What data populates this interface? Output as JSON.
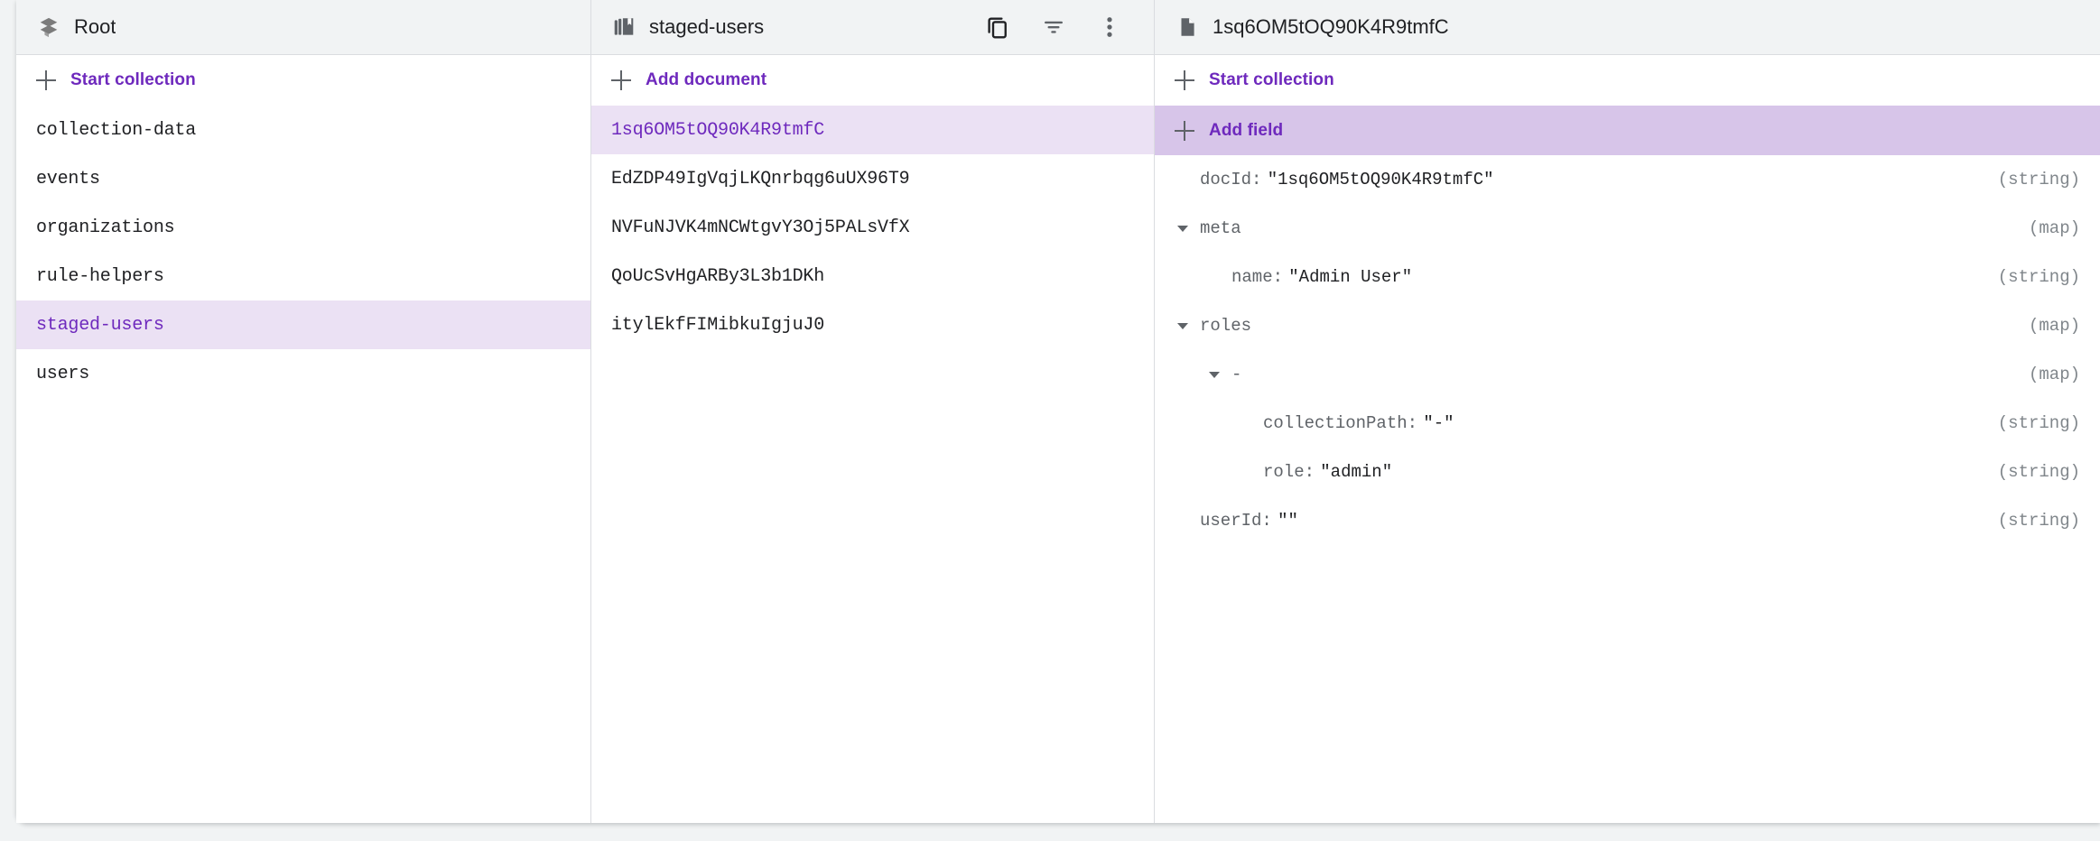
{
  "left_panel": {
    "header": {
      "icon": "firestore-root-icon",
      "title": "Root"
    },
    "add_action": {
      "icon": "plus-icon",
      "label": "Start collection"
    },
    "items": [
      {
        "label": "collection-data",
        "selected": false
      },
      {
        "label": "events",
        "selected": false
      },
      {
        "label": "organizations",
        "selected": false
      },
      {
        "label": "rule-helpers",
        "selected": false
      },
      {
        "label": "staged-users",
        "selected": true
      },
      {
        "label": "users",
        "selected": false
      }
    ]
  },
  "middle_panel": {
    "header": {
      "icon": "collection-icon",
      "title": "staged-users",
      "actions": [
        {
          "icon": "copy-icon",
          "name": "copy-collection-path-button"
        },
        {
          "icon": "filter-icon",
          "name": "filter-query-button"
        },
        {
          "icon": "more-vert-icon",
          "name": "more-options-button"
        }
      ]
    },
    "add_action": {
      "icon": "plus-icon",
      "label": "Add document"
    },
    "items": [
      {
        "label": "1sq6OM5tOQ90K4R9tmfC",
        "selected": true
      },
      {
        "label": "EdZDP49IgVqjLKQnrbqg6uUX96T9",
        "selected": false
      },
      {
        "label": "NVFuNJVK4mNCWtgvY3Oj5PALsVfX",
        "selected": false
      },
      {
        "label": "QoUcSvHgARBy3L3b1DKh",
        "selected": false
      },
      {
        "label": "itylEkfFIMibkuIgjuJ0",
        "selected": false
      }
    ]
  },
  "right_panel": {
    "header": {
      "icon": "document-icon",
      "title": "1sq6OM5tOQ90K4R9tmfC"
    },
    "start_collection": {
      "icon": "plus-icon",
      "label": "Start collection"
    },
    "add_field": {
      "icon": "plus-icon",
      "label": "Add field",
      "highlighted": true
    },
    "fields": [
      {
        "key": "docId",
        "colon": ":",
        "value": "\"1sq6OM5tOQ90K4R9tmfC\"",
        "type": "(string)",
        "indent": 0,
        "expandable": false
      },
      {
        "key": "meta",
        "colon": "",
        "value": "",
        "type": "(map)",
        "indent": 0,
        "expandable": true
      },
      {
        "key": "name",
        "colon": ":",
        "value": "\"Admin User\"",
        "type": "(string)",
        "indent": 1,
        "expandable": false
      },
      {
        "key": "roles",
        "colon": "",
        "value": "",
        "type": "(map)",
        "indent": 0,
        "expandable": true
      },
      {
        "key": "-",
        "colon": "",
        "value": "",
        "type": "(map)",
        "indent": 1,
        "expandable": true
      },
      {
        "key": "collectionPath",
        "colon": ":",
        "value": "\"-\"",
        "type": "(string)",
        "indent": 2,
        "expandable": false
      },
      {
        "key": "role",
        "colon": ":",
        "value": "\"admin\"",
        "type": "(string)",
        "indent": 2,
        "expandable": false
      },
      {
        "key": "userId",
        "colon": ":",
        "value": "\"\"",
        "type": "(string)",
        "indent": 0,
        "expandable": false
      }
    ]
  },
  "colors": {
    "accent_purple": "#6e29bd",
    "selected_row_bg": "#ebe1f4",
    "add_field_bg": "#d7c5e9",
    "header_bg": "#f1f3f4",
    "border": "#dadce0",
    "text_primary": "#202124",
    "text_secondary": "#5f6368"
  }
}
